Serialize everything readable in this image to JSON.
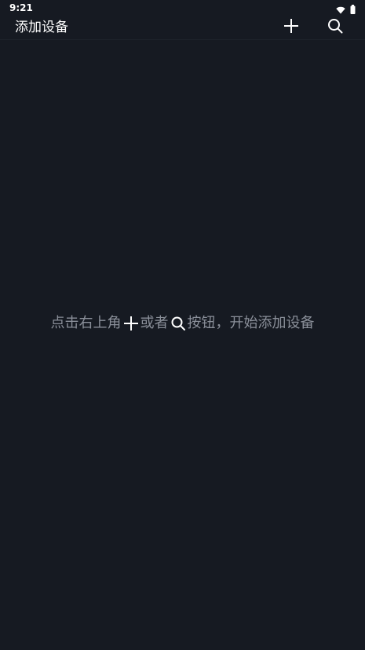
{
  "status_bar": {
    "time": "9:21",
    "icons": [
      "wifi-icon",
      "battery-icon"
    ]
  },
  "app_bar": {
    "title": "添加设备",
    "actions": [
      "plus-icon",
      "search-icon"
    ]
  },
  "empty_state": {
    "text_before_plus": "点击右上角",
    "plus_icon": "plus-icon",
    "text_between": "或者",
    "search_icon": "search-icon",
    "text_after_search": "按钮，开始添加设备"
  },
  "colors": {
    "background": "#161a22",
    "title_text": "#ffffff",
    "hint_text": "#8a8f99"
  }
}
